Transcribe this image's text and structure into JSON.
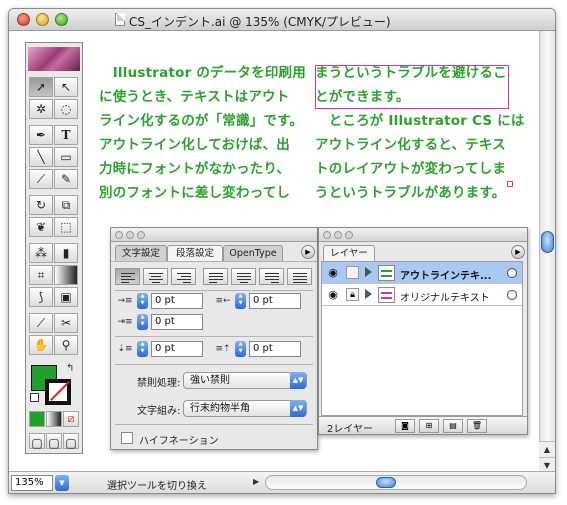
{
  "window": {
    "title": "CS_インデント.ai @ 135% (CMYK/プレビュー)"
  },
  "document": {
    "text_color": "#2da12d",
    "left_column": [
      "　Illustrator のデータを印刷用",
      "に使うとき、テキストはアウト",
      "ライン化するのが「常識」です。",
      "アウトライン化しておけば、出",
      "力時にフォントがなかったり、",
      "別のフォントに差し変わってし"
    ],
    "right_column": [
      "まうというトラブルを避けるこ",
      "とができます。",
      "　ところが Illustrator CS には",
      "アウトライン化すると、テキス",
      "トのレイアウトが変わってしま",
      "うというトラブルがあります。"
    ]
  },
  "toolbox": {
    "tools": [
      "selection-tool",
      "direct-selection-tool",
      "magic-wand-tool",
      "lasso-tool",
      "pen-tool",
      "type-tool",
      "line-tool",
      "rectangle-tool",
      "paintbrush-tool",
      "pencil-tool",
      "rotate-tool",
      "scale-tool",
      "warp-tool",
      "free-transform-tool",
      "symbol-sprayer-tool",
      "column-graph-tool",
      "mesh-tool",
      "gradient-tool",
      "eyedropper-tool",
      "blend-tool",
      "slice-tool",
      "scissors-tool",
      "hand-tool",
      "zoom-tool"
    ],
    "fill_color": "#1fa12b",
    "stroke_color": "none"
  },
  "paragraph_panel": {
    "tabs": [
      "文字設定",
      "段落設定",
      "OpenType"
    ],
    "active_tab": "段落設定",
    "left_indent": "0 pt",
    "right_indent": "0 pt",
    "first_line_indent": "0 pt",
    "space_before": "0 pt",
    "space_after": "0 pt",
    "kinsoku_label": "禁則処理:",
    "kinsoku_value": "強い禁則",
    "mojikumi_label": "文字組み:",
    "mojikumi_value": "行末約物半角",
    "hyphenation_label": "ハイフネーション",
    "hyphenation_checked": false
  },
  "layers_panel": {
    "tab": "レイヤー",
    "layers": [
      {
        "name": "アウトラインテキ...",
        "selected": true,
        "visible": true,
        "locked": false
      },
      {
        "name": "オリジナルテキスト",
        "selected": false,
        "visible": true,
        "locked": true
      }
    ],
    "count_label": "2レイヤー"
  },
  "statusbar": {
    "zoom": "135%",
    "status": "選択ツールを切り換え"
  }
}
